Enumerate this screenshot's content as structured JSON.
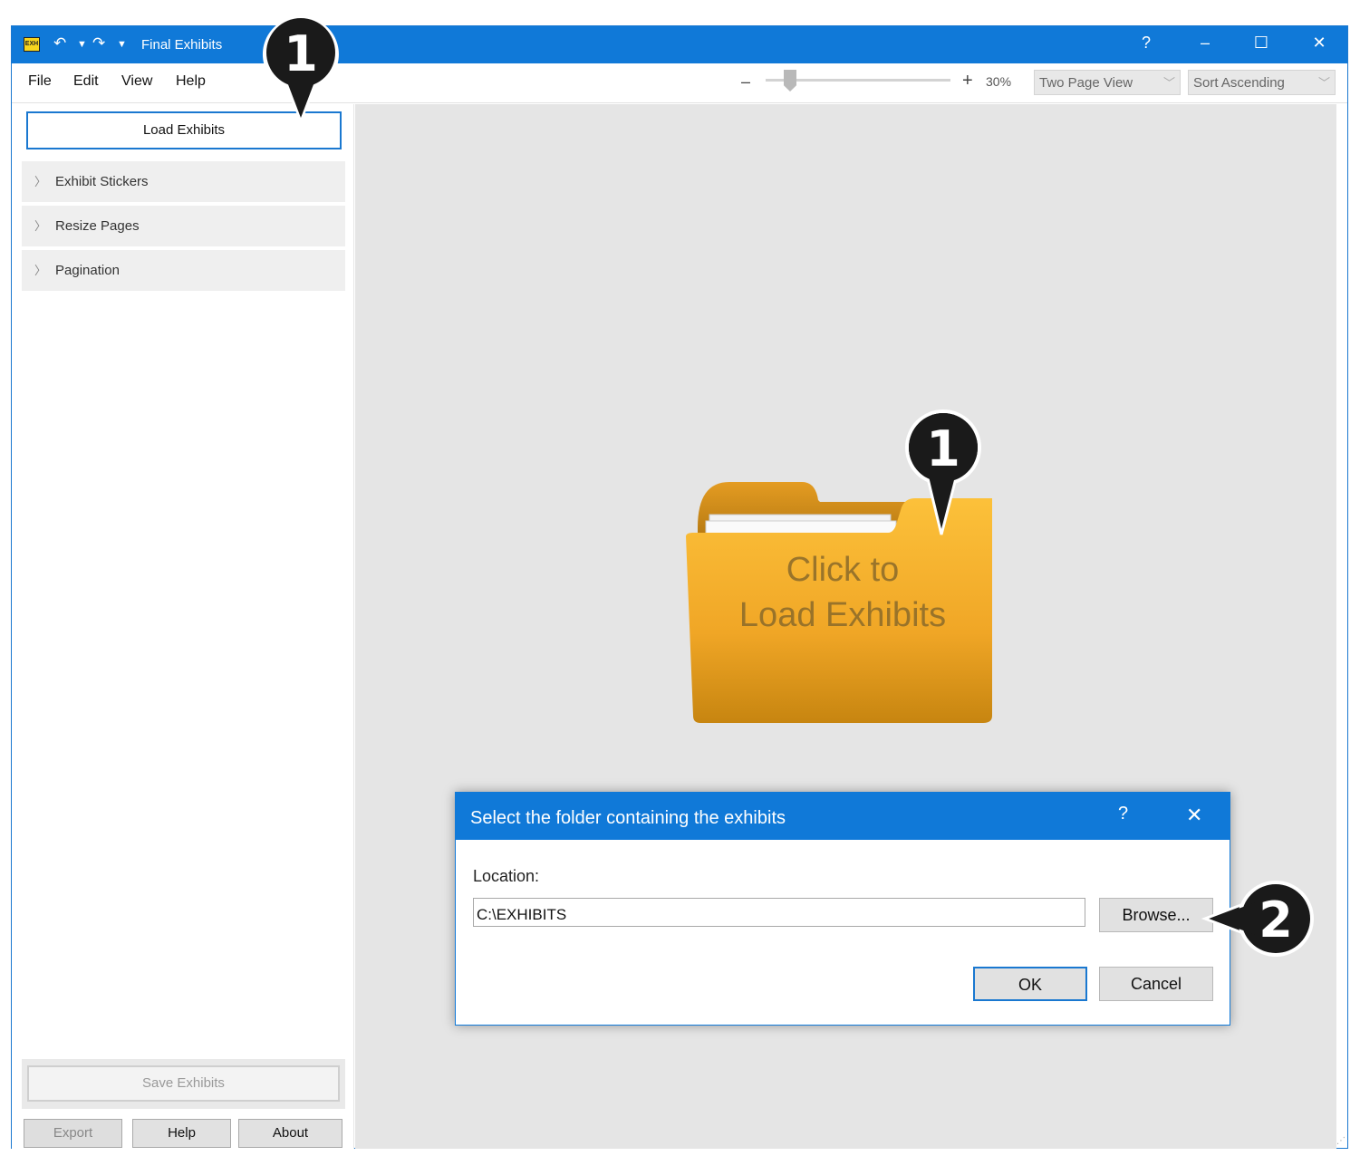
{
  "window": {
    "title": "Final Exhibits",
    "app_icon_text": "EXH",
    "help_glyph": "?",
    "minimize_glyph": "–",
    "maximize_glyph": "☐",
    "close_glyph": "✕"
  },
  "menu": [
    "File",
    "Edit",
    "View",
    "Help"
  ],
  "toolbar": {
    "zoom_minus": "–",
    "zoom_plus": "+",
    "zoom_level": "30%",
    "zoom_fraction": 0.1,
    "view_mode": "Two Page View",
    "sort_mode": "Sort Ascending"
  },
  "sidebar": {
    "load_button": "Load Exhibits",
    "sections": [
      "Exhibit Stickers",
      "Resize Pages",
      "Pagination"
    ],
    "save_button": "Save Exhibits",
    "bottom_buttons": [
      "Export",
      "Help",
      "About"
    ]
  },
  "canvas": {
    "folder_line1": "Click to",
    "folder_line2": "Load Exhibits"
  },
  "dialog": {
    "title": "Select the folder containing the exhibits",
    "help_glyph": "?",
    "close_glyph": "✕",
    "location_label": "Location:",
    "location_value": "C:\\EXHIBITS",
    "browse_button": "Browse...",
    "ok_button": "OK",
    "cancel_button": "Cancel"
  },
  "callouts": [
    "1",
    "1",
    "2"
  ],
  "colors": {
    "accent": "#1079d8",
    "folder": "#f2a920",
    "badge": "#1a1a1a"
  }
}
